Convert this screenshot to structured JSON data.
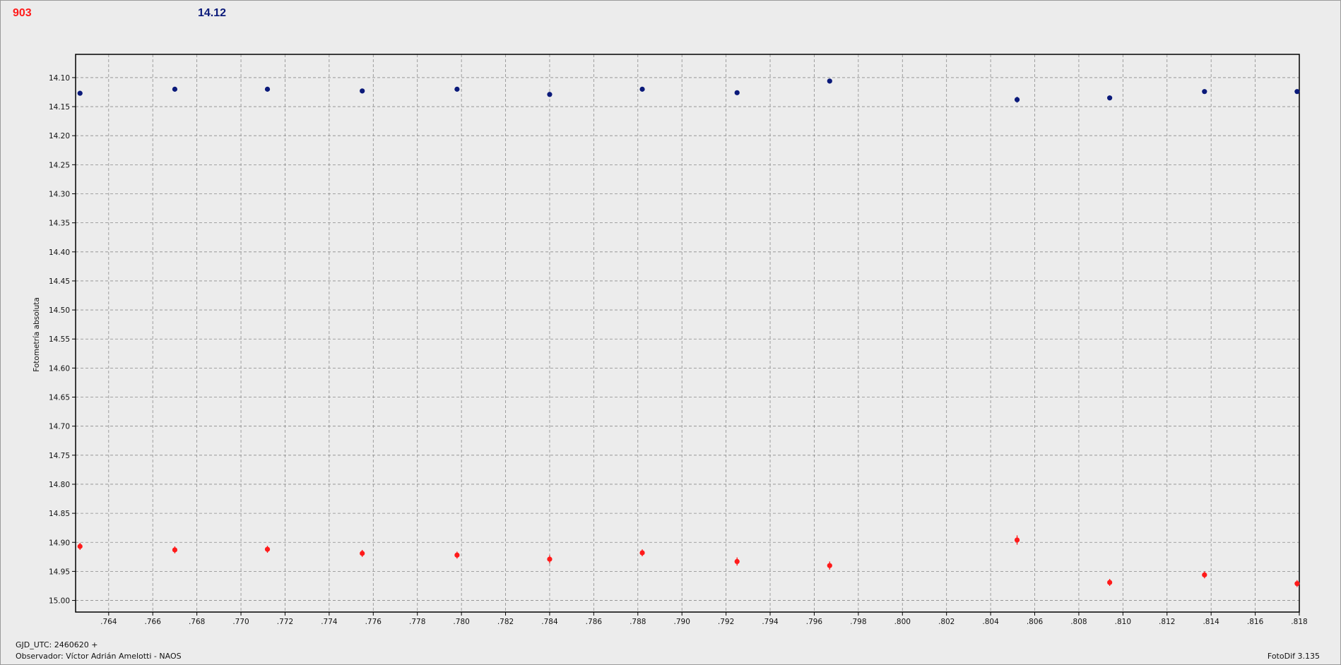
{
  "header": {
    "left_value": "903",
    "right_value": "14.12"
  },
  "footer": {
    "gjd_label": "GJD_UTC: 2460620 +",
    "observer_label": "Observador: Víctor Adrián Amelotti - NAOS",
    "version_label": "FotoDif 3.135"
  },
  "colors": {
    "series_red": "#ff1a1a",
    "series_blue": "#0b1a7a",
    "grid": "#8a8a8a"
  },
  "chart_data": {
    "type": "scatter",
    "title": "",
    "xlabel": "",
    "ylabel": "Fotometría absoluta",
    "xlim": [
      0.7625,
      0.818
    ],
    "ylim": [
      14.06,
      15.02
    ],
    "y_inverted": true,
    "grid": true,
    "legend": "none",
    "x_ticks": [
      "0.764",
      "0.766",
      "0.768",
      "0.770",
      "0.772",
      "0.774",
      "0.776",
      "0.778",
      "0.780",
      "0.782",
      "0.784",
      "0.786",
      "0.788",
      "0.790",
      "0.792",
      "0.794",
      "0.796",
      "0.798",
      "0.800",
      "0.802",
      "0.804",
      "0.806",
      "0.808",
      "0.810",
      "0.812",
      "0.814",
      "0.816",
      "0.818"
    ],
    "y_ticks": [
      "14.10",
      "14.15",
      "14.20",
      "14.25",
      "14.30",
      "14.35",
      "14.40",
      "14.45",
      "14.50",
      "14.55",
      "14.60",
      "14.65",
      "14.70",
      "14.75",
      "14.80",
      "14.85",
      "14.90",
      "14.95",
      "15.00"
    ],
    "series": [
      {
        "color": "#0b1a7a",
        "points": [
          {
            "x": 0.7627,
            "y": 14.127,
            "err": 0.004
          },
          {
            "x": 0.767,
            "y": 14.12,
            "err": 0.004
          },
          {
            "x": 0.7712,
            "y": 14.12,
            "err": 0.004
          },
          {
            "x": 0.7755,
            "y": 14.123,
            "err": 0.004
          },
          {
            "x": 0.7798,
            "y": 14.12,
            "err": 0.004
          },
          {
            "x": 0.784,
            "y": 14.129,
            "err": 0.004
          },
          {
            "x": 0.7882,
            "y": 14.12,
            "err": 0.004
          },
          {
            "x": 0.7925,
            "y": 14.126,
            "err": 0.004
          },
          {
            "x": 0.7967,
            "y": 14.106,
            "err": 0.004
          },
          {
            "x": 0.8052,
            "y": 14.138,
            "err": 0.005
          },
          {
            "x": 0.8094,
            "y": 14.135,
            "err": 0.004
          },
          {
            "x": 0.8137,
            "y": 14.124,
            "err": 0.004
          },
          {
            "x": 0.8179,
            "y": 14.124,
            "err": 0.004
          }
        ]
      },
      {
        "color": "#ff1a1a",
        "points": [
          {
            "x": 0.7627,
            "y": 14.907,
            "err": 0.006
          },
          {
            "x": 0.767,
            "y": 14.913,
            "err": 0.006
          },
          {
            "x": 0.7712,
            "y": 14.912,
            "err": 0.006
          },
          {
            "x": 0.7755,
            "y": 14.919,
            "err": 0.006
          },
          {
            "x": 0.7798,
            "y": 14.922,
            "err": 0.006
          },
          {
            "x": 0.784,
            "y": 14.929,
            "err": 0.007
          },
          {
            "x": 0.7882,
            "y": 14.918,
            "err": 0.006
          },
          {
            "x": 0.7925,
            "y": 14.933,
            "err": 0.007
          },
          {
            "x": 0.7967,
            "y": 14.94,
            "err": 0.007
          },
          {
            "x": 0.8052,
            "y": 14.896,
            "err": 0.008
          },
          {
            "x": 0.8094,
            "y": 14.969,
            "err": 0.006
          },
          {
            "x": 0.8137,
            "y": 14.956,
            "err": 0.006
          },
          {
            "x": 0.8179,
            "y": 14.971,
            "err": 0.006
          }
        ]
      }
    ]
  }
}
